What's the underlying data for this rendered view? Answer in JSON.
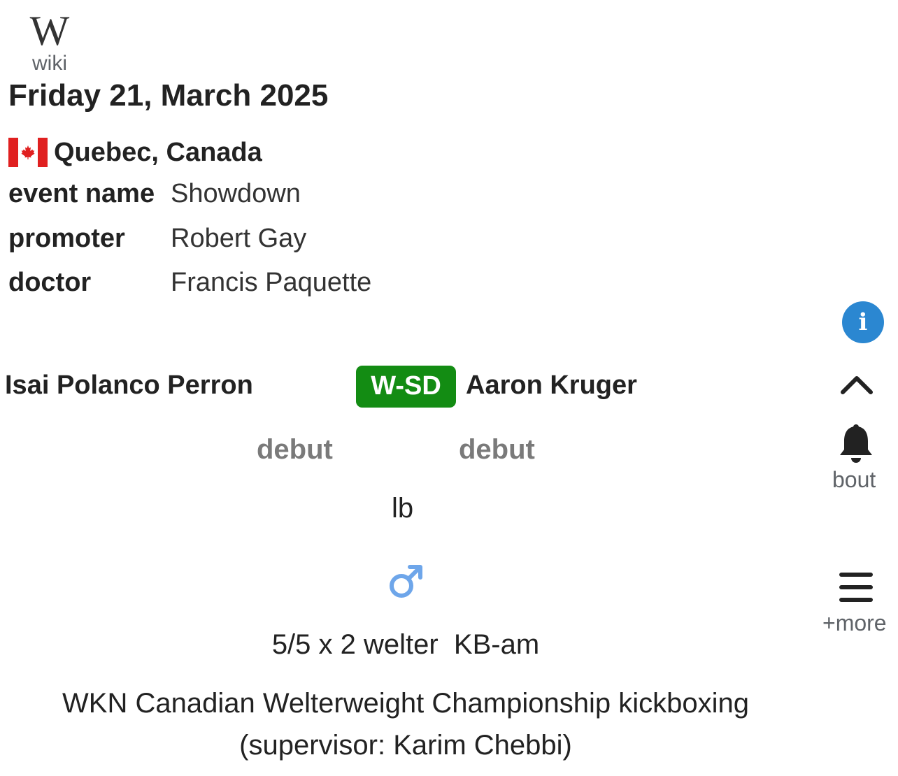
{
  "logo": {
    "label": "wiki"
  },
  "event": {
    "date": "Friday 21, March 2025",
    "location": "Quebec, Canada",
    "details": [
      {
        "key": "event name",
        "value": "Showdown"
      },
      {
        "key": "promoter",
        "value": "Robert Gay"
      },
      {
        "key": "doctor",
        "value": "Francis Paquette"
      }
    ]
  },
  "bout": {
    "fighter_left": "Isai Polanco Perron",
    "result": "W-SD",
    "fighter_right": "Aaron Kruger",
    "record_left": "debut",
    "record_right": "debut",
    "weight": "lb",
    "rules": "5/5 x 2 welter  KB-am",
    "title_line1": "WKN Canadian Welterweight Championship kickboxing",
    "title_line2": "(supervisor: Karim Chebbi)"
  },
  "side": {
    "bout_label": "bout",
    "more_label": "+more"
  },
  "colors": {
    "result_badge": "#138c13",
    "info_button": "#2b87d1",
    "gender_icon": "#6ea6ea",
    "flag_red": "#e02020"
  },
  "icons": [
    "wikipedia-logo-icon",
    "canada-flag-icon",
    "info-icon",
    "chevron-up-icon",
    "bell-icon",
    "male-gender-icon",
    "hamburger-menu-icon"
  ]
}
